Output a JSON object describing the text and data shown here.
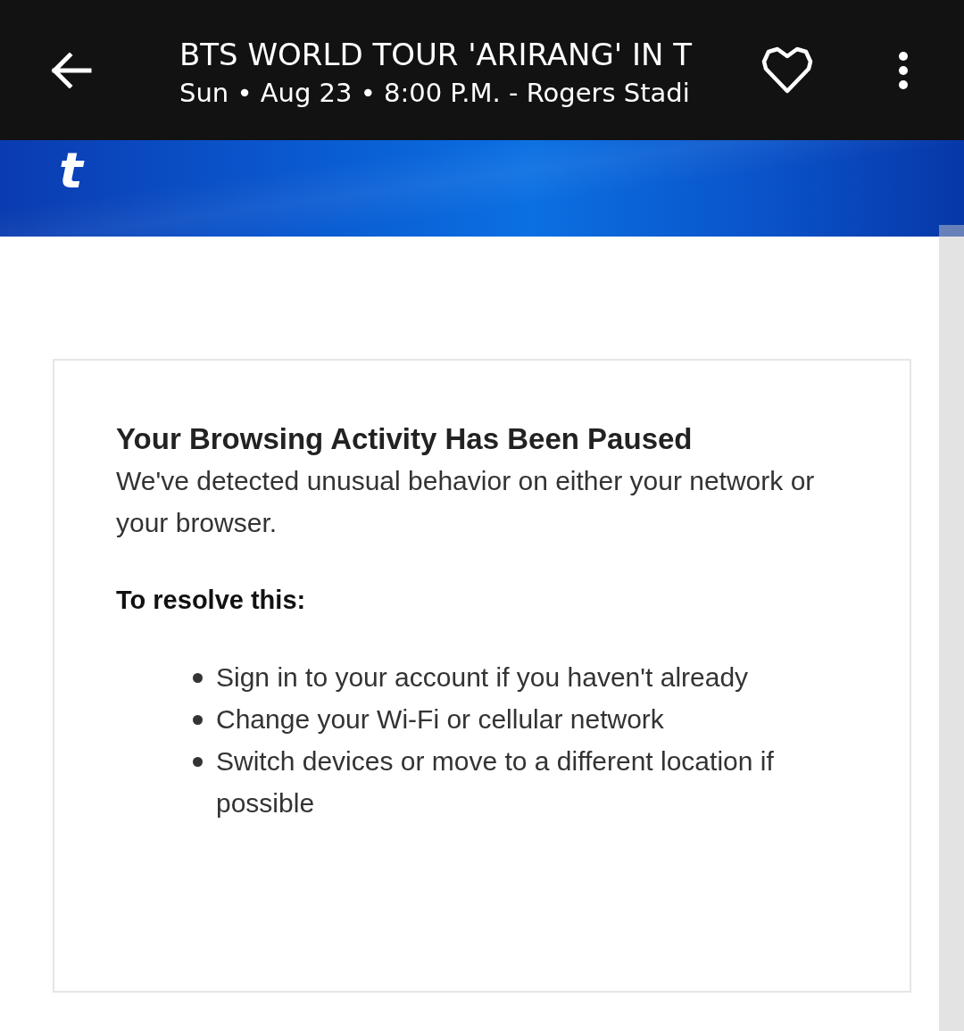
{
  "header": {
    "title": "BTS WORLD TOUR 'ARIRANG' IN T",
    "subtitle": "Sun • Aug 23 • 8:00 P.M. - Rogers Stadi",
    "saved": false
  },
  "banner": {
    "logo": "t"
  },
  "notice": {
    "heading": "Your Browsing Activity Has Been Paused",
    "message": "We've detected unusual behavior on either your network or your browser.",
    "steps_heading": "To resolve this:",
    "steps": [
      "Sign in to your account if you haven't already",
      "Change your Wi-Fi or cellular network",
      "Switch devices or move to a different location if possible"
    ]
  }
}
